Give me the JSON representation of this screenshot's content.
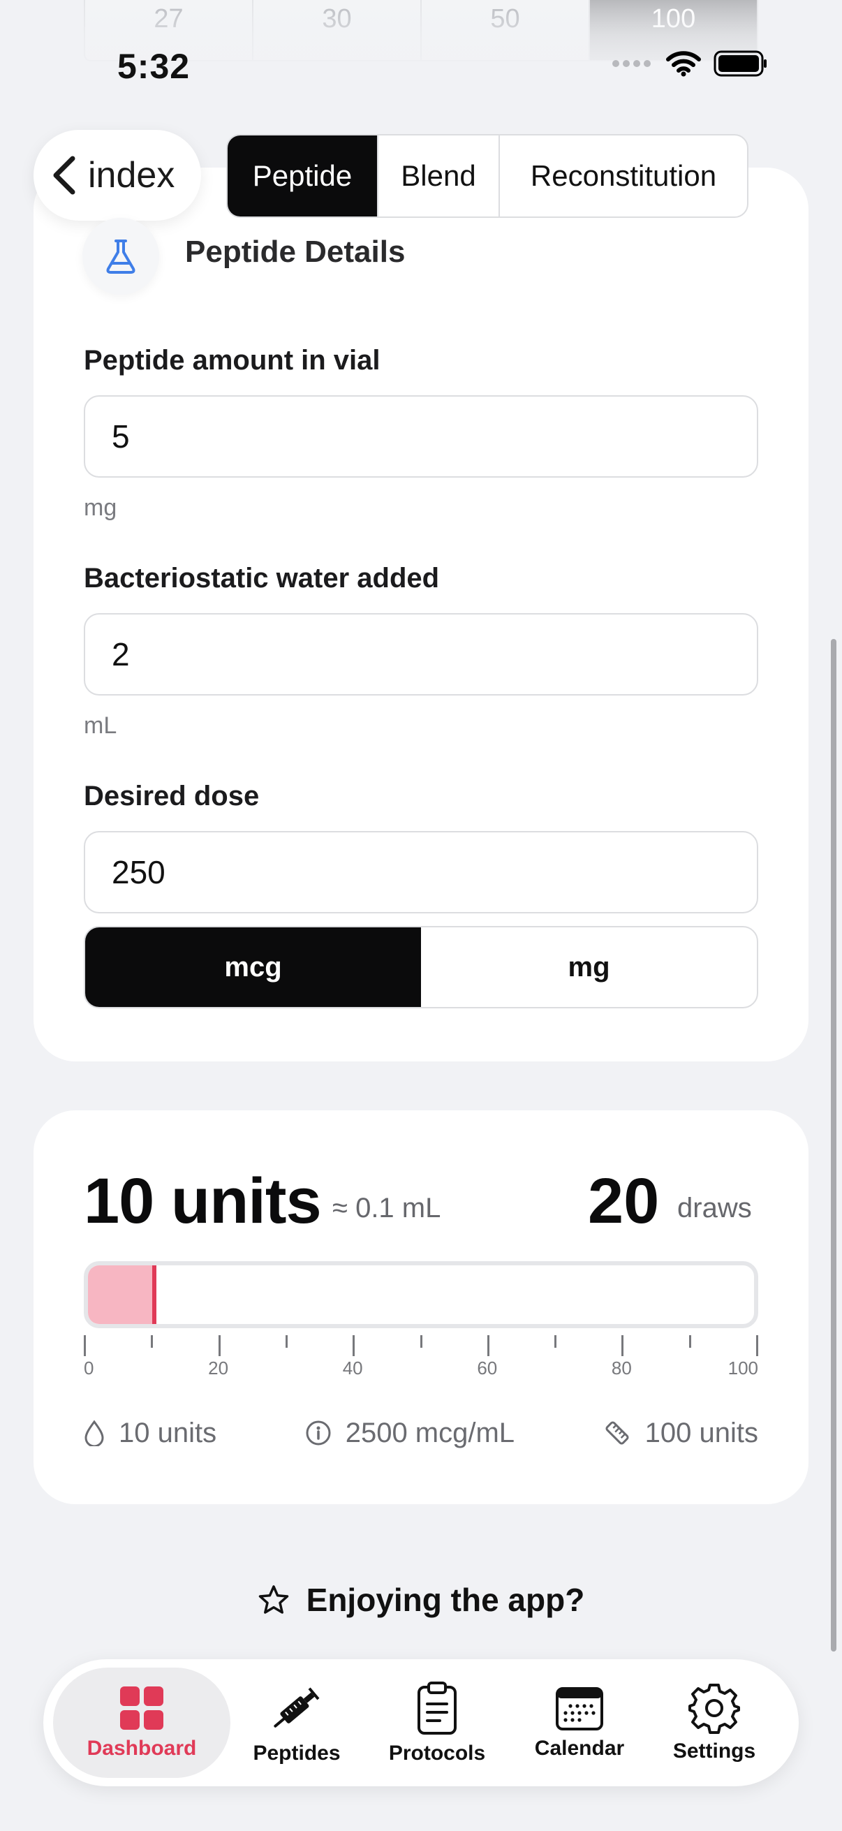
{
  "syringe_sizes": [
    "27",
    "30",
    "50",
    "100"
  ],
  "syringe_active": "100",
  "status": {
    "time": "5:32"
  },
  "nav": {
    "back_label": "index"
  },
  "mode_tabs": [
    {
      "label": "Peptide",
      "active": true
    },
    {
      "label": "Blend",
      "active": false
    },
    {
      "label": "Reconstitution",
      "active": false
    }
  ],
  "details": {
    "title": "Peptide Details",
    "amount_label": "Peptide amount in vial",
    "amount_value": "5",
    "amount_unit": "mg",
    "water_label": "Bacteriostatic water added",
    "water_value": "2",
    "water_unit": "mL",
    "dose_label": "Desired dose",
    "dose_value": "250",
    "dose_units": [
      "mcg",
      "mg"
    ],
    "dose_unit_selected": "mcg"
  },
  "result": {
    "units": "10 units",
    "volume": "≈ 0.1 mL",
    "draws": "20",
    "draws_label": "draws",
    "gauge_value": 10,
    "gauge_max": 100,
    "tick_labels": [
      "0",
      "20",
      "40",
      "60",
      "80",
      "100"
    ],
    "stats": [
      {
        "icon": "drop-icon",
        "text": "10 units"
      },
      {
        "icon": "info-icon",
        "text": "2500 mcg/mL"
      },
      {
        "icon": "ruler-icon",
        "text": "100 units"
      }
    ]
  },
  "feedback": {
    "text": "Enjoying the app?"
  },
  "tabbar": [
    {
      "label": "Dashboard",
      "icon": "grid-icon",
      "active": true
    },
    {
      "label": "Peptides",
      "icon": "syringe-icon",
      "active": false
    },
    {
      "label": "Protocols",
      "icon": "clipboard-icon",
      "active": false
    },
    {
      "label": "Calendar",
      "icon": "calendar-icon",
      "active": false
    },
    {
      "label": "Settings",
      "icon": "gear-icon",
      "active": false
    }
  ],
  "colors": {
    "accent": "#e03a57",
    "gauge_fill": "#f7b6c2",
    "dark": "#0b0b0c"
  }
}
